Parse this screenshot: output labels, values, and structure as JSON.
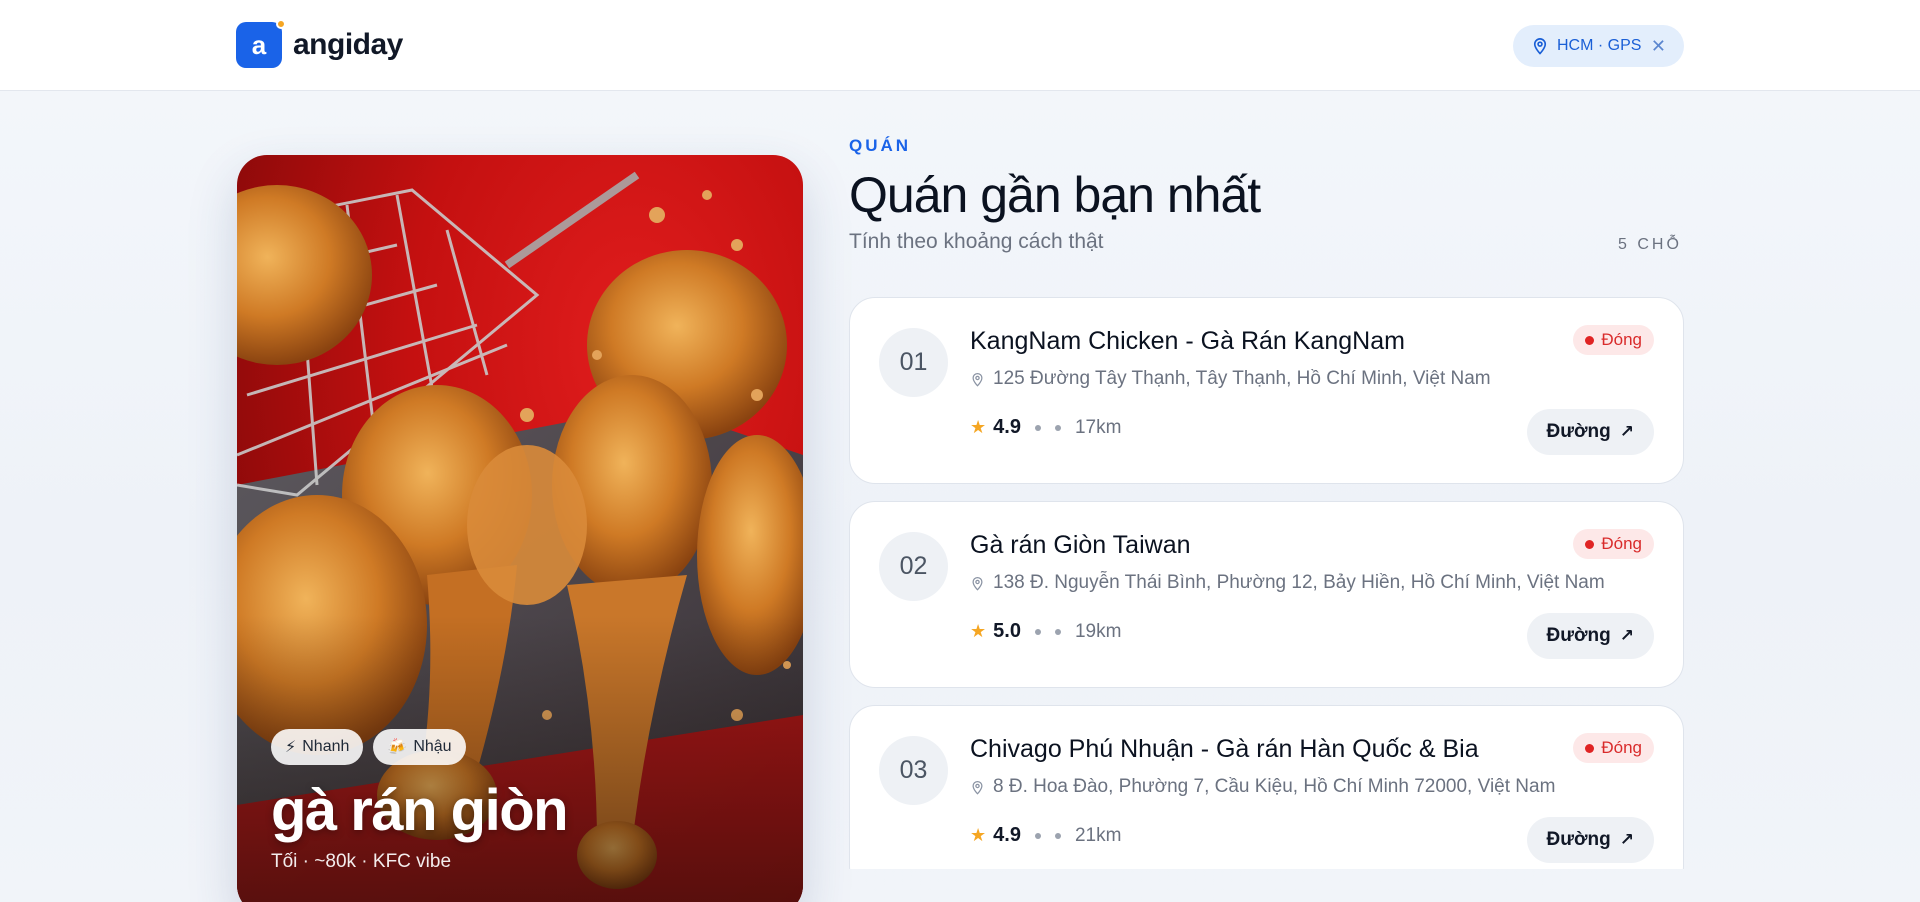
{
  "brand": {
    "logo_letter": "a",
    "name": "angiday",
    "accent": "#1a63e8"
  },
  "location": {
    "label": "HCM · GPS",
    "clear_icon": "close-icon"
  },
  "hero": {
    "tags": [
      {
        "icon": "lightning-icon",
        "glyph": "⚡",
        "label": "Nhanh"
      },
      {
        "icon": "beer-icon",
        "glyph": "🍻",
        "label": "Nhậu"
      }
    ],
    "title": "gà rán giòn",
    "subtitle": "Tối · ~80k · KFC vibe"
  },
  "section": {
    "eyebrow": "QUÁN",
    "title": "Quán gần bạn nhất",
    "subtitle": "Tính theo khoảng cách thật",
    "count": "5 CHỖ"
  },
  "places": [
    {
      "index": "01",
      "name": "KangNam Chicken - Gà Rán KangNam",
      "address": "125 Đường Tây Thạnh, Tây Thạnh, Hồ Chí Minh, Việt Nam",
      "rating": "4.9",
      "distance": "17km",
      "status": "Đóng",
      "action": "Đường"
    },
    {
      "index": "02",
      "name": "Gà rán Giòn Taiwan",
      "address": "138 Đ. Nguyễn Thái Bình, Phường 12, Bảy Hiền, Hồ Chí Minh, Việt Nam",
      "rating": "5.0",
      "distance": "19km",
      "status": "Đóng",
      "action": "Đường"
    },
    {
      "index": "03",
      "name": "Chivago Phú Nhuận - Gà rán Hàn Quốc & Bia",
      "address": "8 Đ. Hoa Đào, Phường 7, Cầu Kiệu, Hồ Chí Minh 72000, Việt Nam",
      "rating": "4.9",
      "distance": "21km",
      "status": "Đóng",
      "action": "Đường"
    }
  ]
}
